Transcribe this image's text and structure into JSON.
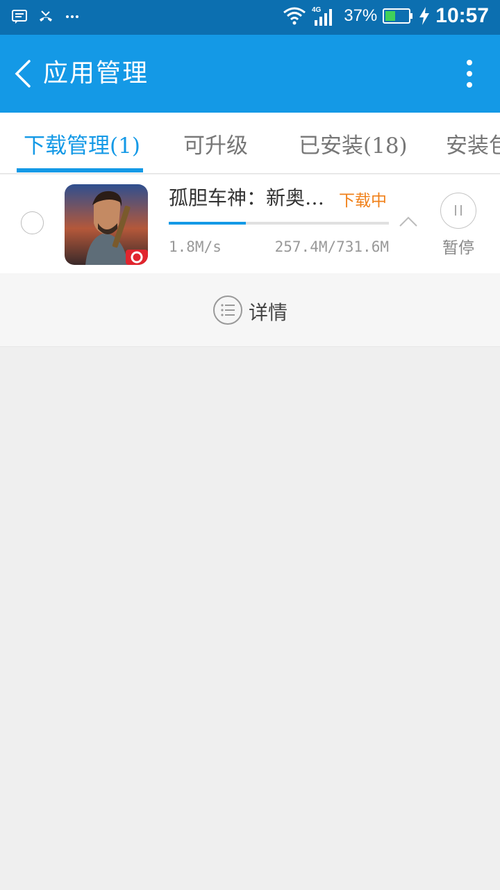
{
  "status_bar": {
    "network": "4G",
    "battery_percent": "37%",
    "time": "10:57"
  },
  "app_bar": {
    "title": "应用管理"
  },
  "tabs": [
    {
      "label": "下载管理(1)",
      "active": true
    },
    {
      "label": "可升级",
      "active": false
    },
    {
      "label": "已安装(18)",
      "active": false
    },
    {
      "label": "安装包",
      "active": false
    }
  ],
  "download": {
    "app_name": "孤胆车神：新奥…",
    "status": "下载中",
    "speed": "1.8M/s",
    "size": "257.4M/731.6M",
    "progress": 0.35,
    "pause_label": "暂停"
  },
  "details": {
    "label": "详情"
  },
  "colors": {
    "accent": "#1499e6",
    "status_bar": "#0c6fb0",
    "status_orange": "#f08019"
  }
}
